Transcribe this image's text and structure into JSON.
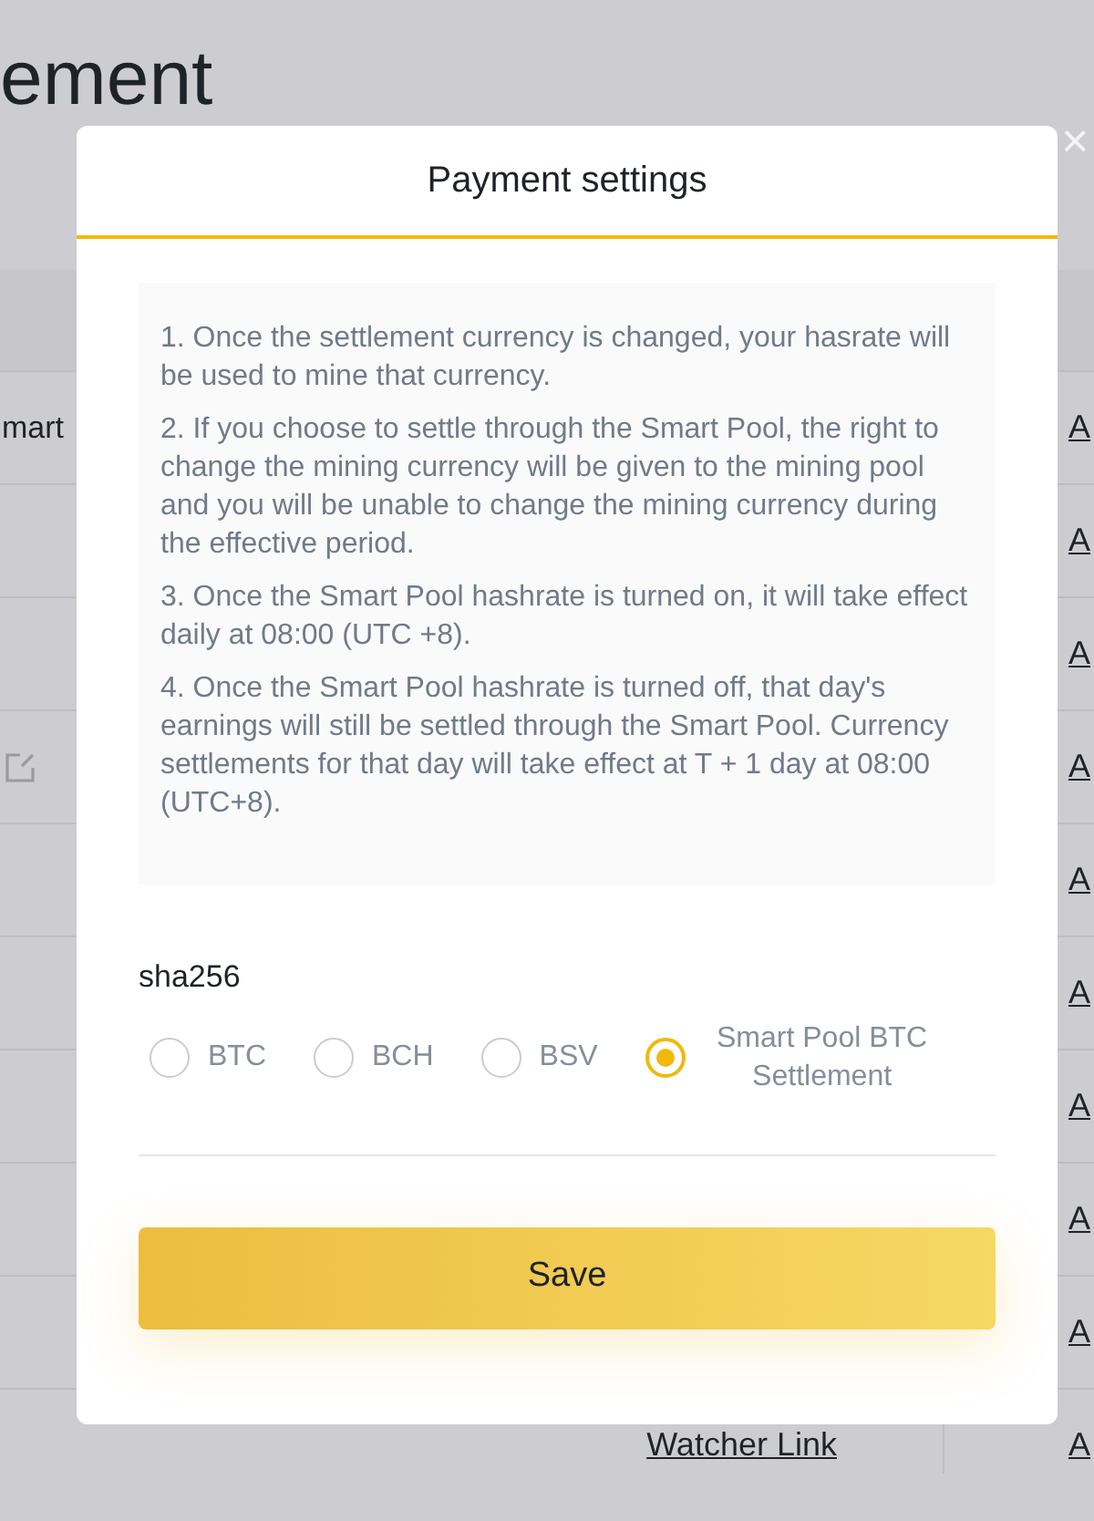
{
  "background": {
    "heading": "ement",
    "close": "×",
    "rows": [
      {
        "kind": "label",
        "left": "mart",
        "link": "A"
      },
      {
        "kind": "plain",
        "link": "A"
      },
      {
        "kind": "plain",
        "link": "A"
      },
      {
        "kind": "edit",
        "link": "A"
      },
      {
        "kind": "plain",
        "link": "A"
      },
      {
        "kind": "plain",
        "link": "A"
      },
      {
        "kind": "plain",
        "link": "A"
      },
      {
        "kind": "plain",
        "link": "A"
      },
      {
        "kind": "plain",
        "link": "A"
      },
      {
        "kind": "watcher",
        "middle": "Watcher Link",
        "link": "A"
      }
    ]
  },
  "dialog": {
    "title": "Payment settings",
    "notes": [
      "1. Once the settlement currency is changed, your hasrate will be used to mine that currency.",
      "2. If you choose to settle through the Smart Pool, the right to change the mining currency will be given to the mining pool and you will be unable to change the mining currency during the effective period.",
      "3. Once the Smart Pool hashrate is turned on, it will take effect daily at 08:00 (UTC +8).",
      "4. Once the Smart Pool hashrate is turned off, that day's earnings will still be settled through the Smart Pool. Currency settlements for that day will take effect at T + 1 day at 08:00 (UTC+8)."
    ],
    "algorithm": "sha256",
    "options": [
      {
        "label": "BTC",
        "selected": false
      },
      {
        "label": "BCH",
        "selected": false
      },
      {
        "label": "BSV",
        "selected": false
      },
      {
        "label": "Smart Pool BTC Settlement",
        "selected": true
      }
    ],
    "save": "Save"
  }
}
